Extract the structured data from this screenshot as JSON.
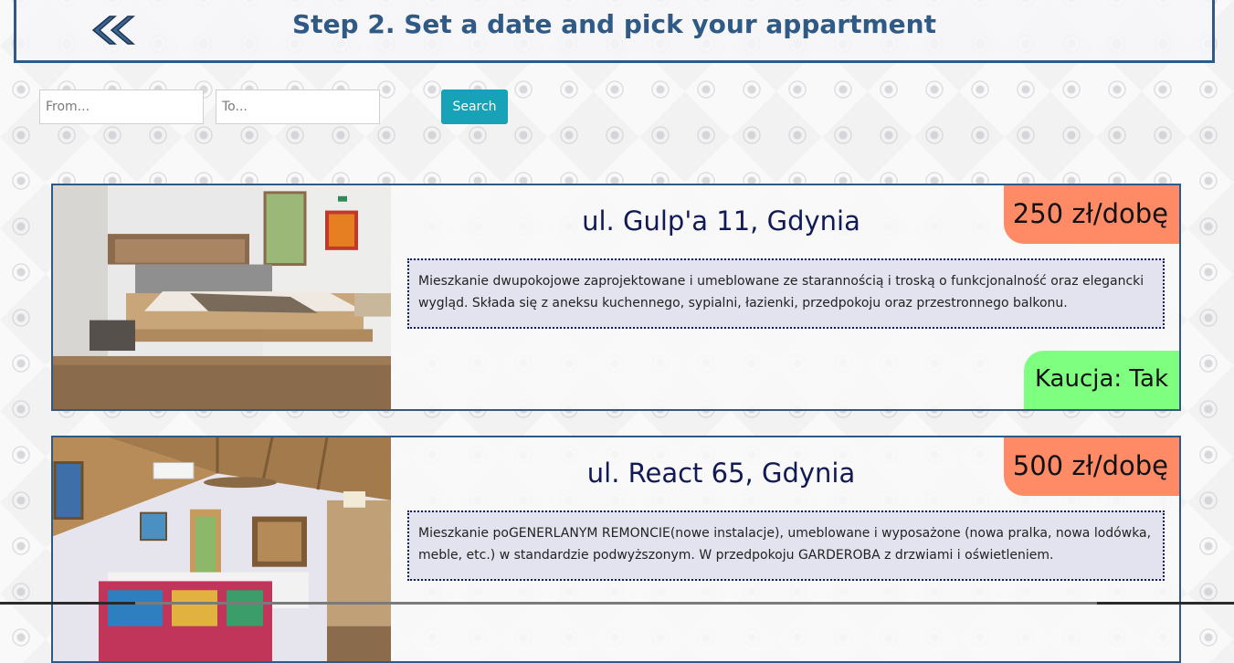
{
  "header": {
    "title": "Step 2. Set a date and pick your appartment",
    "back_icon": "double-chevron-left-icon"
  },
  "search": {
    "from_placeholder": "From...",
    "to_placeholder": "To...",
    "button_label": "Search"
  },
  "colors": {
    "accent": "#2f5a85",
    "search_button": "#17a2b8",
    "price_badge": "#ff8a66",
    "deposit_badge": "#7fff7f",
    "description_bg": "#e3e3ef"
  },
  "apartments": [
    {
      "address": "ul. Gulp'a 11, Gdynia",
      "price": "250 zł/dobę",
      "description": "Mieszkanie dwupokojowe zaprojektowane i umeblowane ze starannością i troską o funkcjonalność oraz elegancki wygląd. Składa się z aneksu kuchennego, sypialni, łazienki, przedpokoju oraz przestronnego balkonu.",
      "deposit": "Kaucja: Tak",
      "image": "bedroom-photo"
    },
    {
      "address": "ul. React 65, Gdynia",
      "price": "500 zł/dobę",
      "description": "Mieszkanie poGENERLANYM REMONCIE(nowe instalacje), umeblowane i wyposażone (nowa pralka, nowa lodówka, meble, etc.) w standardzie podwyższonym. W przedpokoju GARDEROBA z drzwiami i oświetleniem.",
      "image": "bedroom-photo"
    }
  ]
}
